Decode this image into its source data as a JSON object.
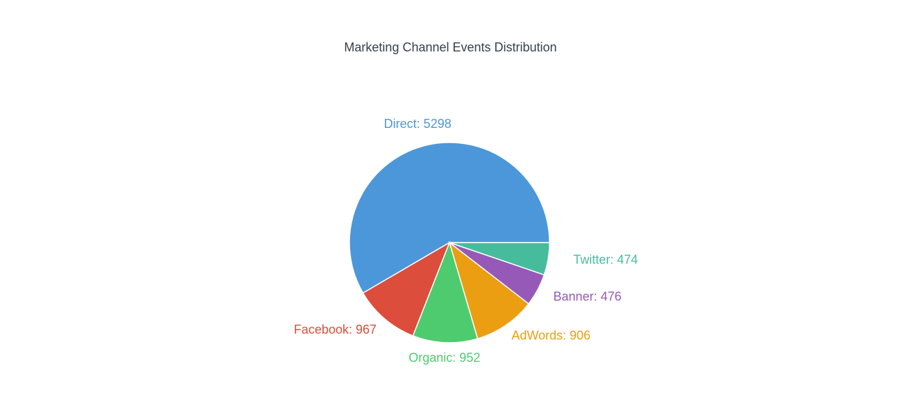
{
  "chart_data": {
    "type": "pie",
    "title": "Marketing Channel Events Distribution",
    "slices": [
      {
        "label": "Direct",
        "value": 5298,
        "color": "#4c97da",
        "text": "Direct: 5298"
      },
      {
        "label": "Twitter",
        "value": 474,
        "color": "#46bc9d",
        "text": "Twitter: 474"
      },
      {
        "label": "Banner",
        "value": 476,
        "color": "#9659b7",
        "text": "Banner: 476"
      },
      {
        "label": "AdWords",
        "value": 906,
        "color": "#eb9e12",
        "text": "AdWords: 906"
      },
      {
        "label": "Organic",
        "value": 952,
        "color": "#4ecb6f",
        "text": "Organic: 952"
      },
      {
        "label": "Facebook",
        "value": 967,
        "color": "#dc4d3b",
        "text": "Facebook: 967"
      }
    ],
    "legend": "none"
  }
}
